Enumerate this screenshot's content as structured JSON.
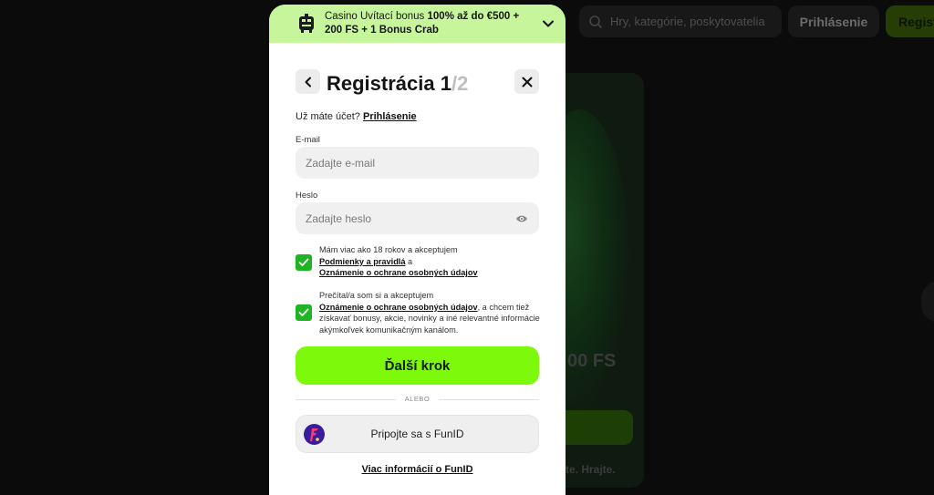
{
  "background": {
    "search_placeholder": "Hry, kategórie, poskytovatelia",
    "login_label": "Prihlásenie",
    "register_label": "Regist",
    "card_fs_text": "00 FS",
    "card_footer_text": "te. Hrajte."
  },
  "banner": {
    "prefix": "Casino Uvítací bonus ",
    "bold": "100% až do €500 + 200 FS + 1 Bonus Crab"
  },
  "header": {
    "title": "Registrácia 1",
    "step_total": "/2"
  },
  "account": {
    "prompt": "Už máte účet? ",
    "login_link": "Prihlásenie"
  },
  "form": {
    "email_label": "E-mail",
    "email_placeholder": "Zadajte e-mail",
    "password_label": "Heslo",
    "password_placeholder": "Zadajte heslo"
  },
  "consents": {
    "age_text": "Mám viac ako 18 rokov a akceptujem",
    "terms_link": "Podmienky a pravidlá",
    "and": " a",
    "privacy_link": "Oznámenie o ochrane osobných údajov",
    "marketing_text_before": "Prečítal/a som si a akceptujem",
    "marketing_privacy_link": "Oznámenie o ochrane osobných údajov",
    "marketing_text_after": ", a chcem tiež získavať bonusy, akcie, novinky a iné relevantné informácie akýmkoľvek komunikačným kanálom."
  },
  "actions": {
    "next_label": "Ďalší krok",
    "divider_label": "ALEBO",
    "funid_label": "Pripojte sa s FunID",
    "more_info_link": "Viac informácií o FunID"
  },
  "colors": {
    "accent_green": "#7dfa0c",
    "banner_green": "#c7f59c",
    "checkbox_green": "#1fb424",
    "funid_purple": "#3a1c9c"
  },
  "icons": {
    "banner": "robot-gift-icon",
    "banner_toggle": "chevron-down-icon",
    "back": "chevron-left-icon",
    "close": "close-icon",
    "password_toggle": "eye-icon",
    "check": "checkmark-icon",
    "funid": "funid-logo-icon",
    "search": "search-icon"
  }
}
